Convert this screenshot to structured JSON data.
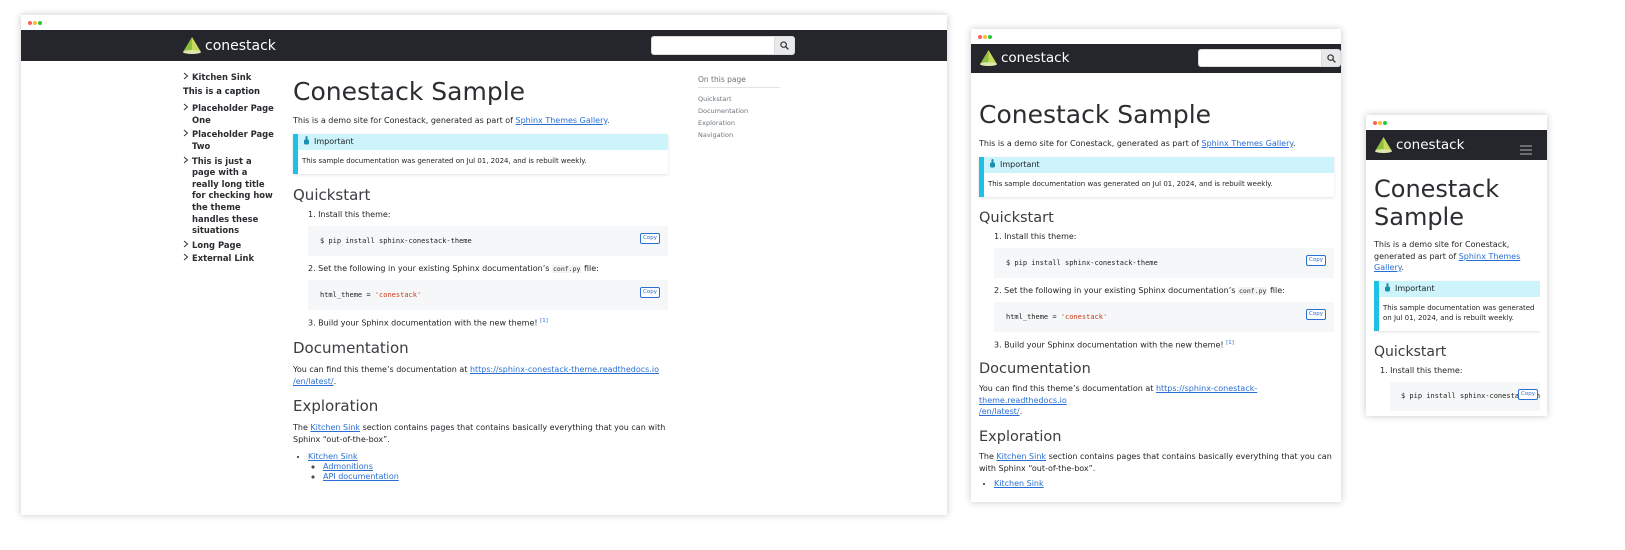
{
  "brand": {
    "name": "conestack"
  },
  "search": {
    "placeholder": ""
  },
  "icons": {
    "search": "search-icon",
    "menu": "hamburger-menu-icon",
    "important": "hand-pointer-icon",
    "chevron": "chevron-right-icon"
  },
  "colors": {
    "navbar": "#24262b",
    "admonition": "#1ec0e3",
    "link": "#2a6fd3"
  },
  "sidebar": {
    "items": [
      {
        "label": "Kitchen Sink"
      },
      {
        "label": "Placeholder Page One"
      },
      {
        "label": "Placeholder Page Two"
      },
      {
        "label": "This is just a page with a really long title for checking how the theme handles these situations"
      },
      {
        "label": "Long Page"
      },
      {
        "label": "External Link"
      }
    ],
    "caption": "This is a caption"
  },
  "toc": {
    "title": "On this page",
    "items": [
      "Quickstart",
      "Documentation",
      "Exploration",
      "Navigation"
    ]
  },
  "page": {
    "title": "Conestack Sample",
    "intro_prefix": "This is a demo site for Conestack, generated as part of ",
    "intro_link": "Sphinx Themes Gallery",
    "intro_suffix": ".",
    "important": {
      "title": "Important",
      "text": "This sample documentation was generated on Jul 01, 2024, and is rebuilt weekly."
    },
    "quickstart": {
      "heading": "Quickstart",
      "step1": "1. Install this theme:",
      "code1": "$ pip install sphinx-conestack-theme",
      "step2_prefix": "2. Set the following in your existing Sphinx documentation’s ",
      "step2_code": "conf.py",
      "step2_suffix": " file:",
      "code2_key": "html_theme",
      "code2_op": " = ",
      "code2_val": "'conestack'",
      "step3": "3. Build your Sphinx documentation with the new theme! ",
      "footnote": "[1]",
      "copy_label": "Copy"
    },
    "documentation": {
      "heading": "Documentation",
      "text_prefix": "You can find this theme’s documentation at ",
      "link_line1": "https://sphinx-conestack-theme.readthedocs.io",
      "link_line2": "/en/latest/",
      "text_suffix": "."
    },
    "exploration": {
      "heading": "Exploration",
      "text_prefix": "The ",
      "text_link": "Kitchen Sink",
      "text_suffix": " section contains pages that contains basically everything that you can with Sphinx “out-of-the-box”.",
      "list": [
        "Kitchen Sink"
      ],
      "sublist": [
        "Admonitions",
        "API documentation"
      ]
    }
  }
}
